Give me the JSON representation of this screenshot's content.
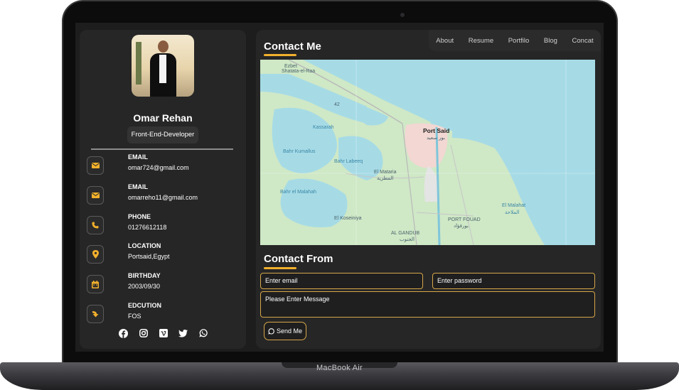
{
  "device": {
    "label": "MacBook Air"
  },
  "profile": {
    "name": "Omar Rehan",
    "role": "Front-End-Developer"
  },
  "contacts": [
    {
      "label": "EMAIL",
      "value": "omar724@gmail.com",
      "icon": "envelope-icon"
    },
    {
      "label": "EMAIL",
      "value": "omarreho11@gmail.com",
      "icon": "envelope-icon"
    },
    {
      "label": "PHONE",
      "value": "01276612118",
      "icon": "phone-icon"
    },
    {
      "label": "LOCATION",
      "value": "Portsaid,Egypt",
      "icon": "map-pin-icon"
    },
    {
      "label": "BIRTHDAY",
      "value": "2003/09/30",
      "icon": "calendar-icon"
    },
    {
      "label": "EDCUTION",
      "value": "FOS",
      "icon": "education-icon"
    }
  ],
  "socials": [
    "facebook-icon",
    "instagram-icon",
    "vimeo-icon",
    "twitter-icon",
    "whatsapp-icon"
  ],
  "nav": [
    "About",
    "Resume",
    "Portfilo",
    "Blog",
    "Concat"
  ],
  "contact_section": {
    "title": "Contact Me"
  },
  "map": {
    "labels": {
      "ezbet": "Ezbet",
      "shata": "Shatata-el-Raa",
      "port_said": "Port Said",
      "port_said_ar": "بور سعيد",
      "bahr_kumallus": "Bahr Kumallus",
      "bahr_el_malahah": "Bahr el Malahah",
      "el_mataria": "El Mataria",
      "el_manasra": "المطرية",
      "el_koseiniya": "El Koseiniya",
      "al_qanoub": "AL GANDUB",
      "al_qanoub_ar": "الجنوب",
      "port_fouad": "PORT FOUAD",
      "port_fouad_ar": "بورفؤاد",
      "el_malahat": "El Malahat",
      "el_malahat_ar": "الملاحة",
      "road_42": "42",
      "kassarah": "Kassarah",
      "bahr_labeeq": "Bahr Labeeq"
    },
    "colors": {
      "water": "#a6dbe6",
      "land": "#cfe8c6",
      "urban": "#f2d7d2",
      "road": "#b9b9b9"
    }
  },
  "form": {
    "title": "Contact From",
    "email_placeholder": "Enter email",
    "password_placeholder": "Enter password",
    "message_placeholder": "Please Enter Message",
    "send_label": "Send Me"
  },
  "colors": {
    "accent": "#f2b02c",
    "card": "#262626",
    "background": "#1d1d1d"
  }
}
